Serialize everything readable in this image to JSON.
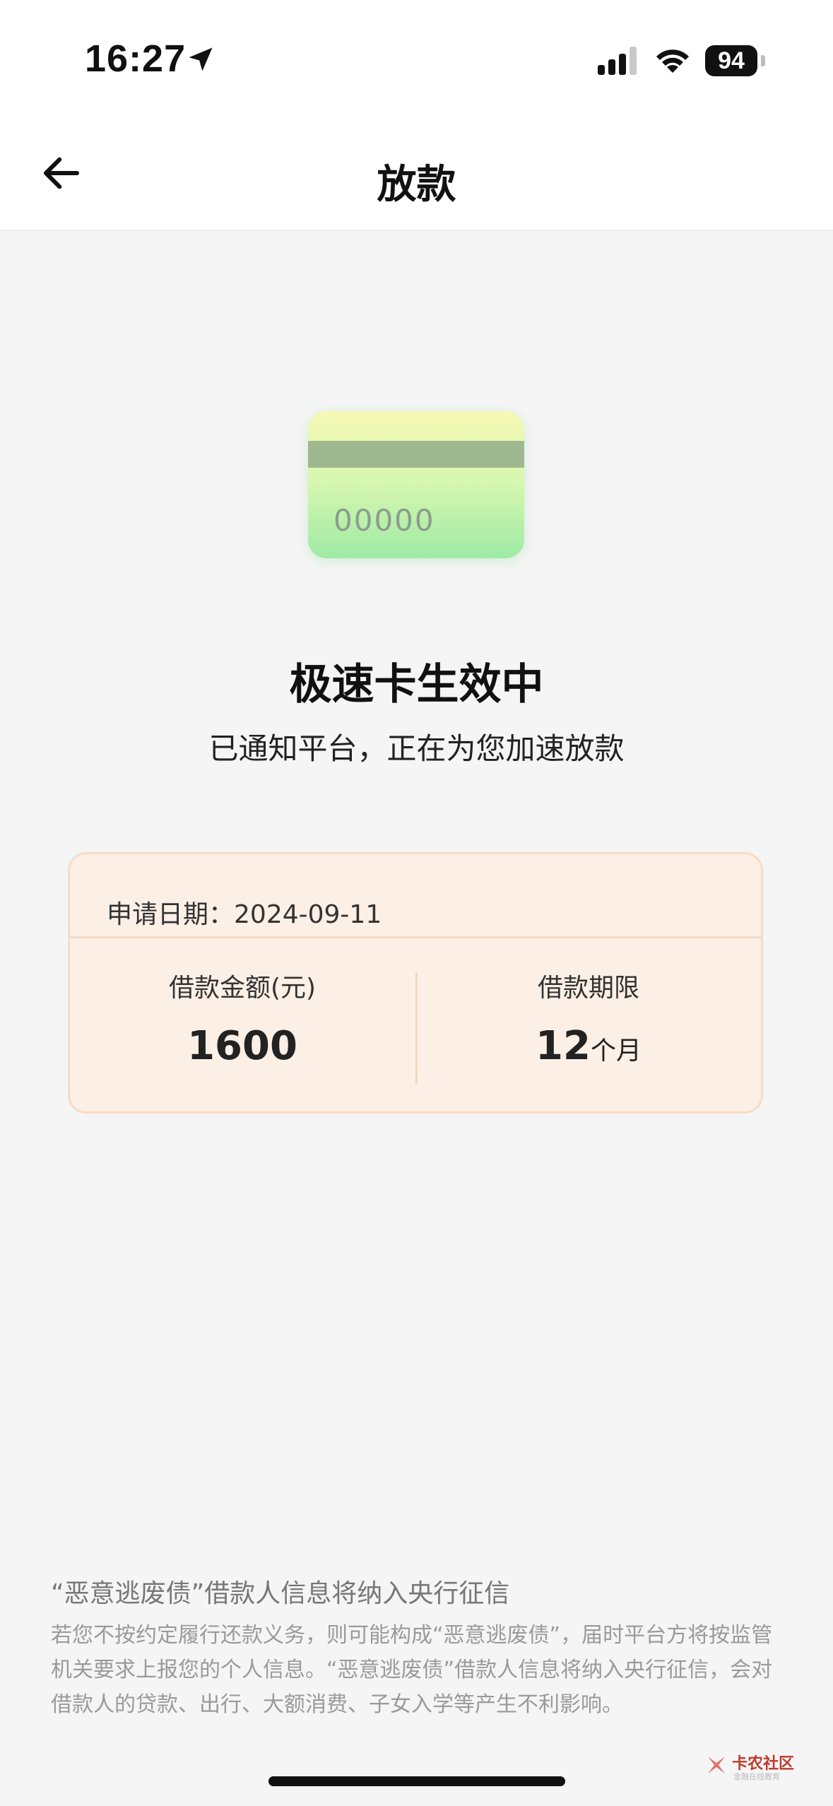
{
  "status_bar": {
    "time": "16:27",
    "battery": "94",
    "icons": [
      "location-arrow-icon",
      "cellular-signal-icon",
      "wifi-icon",
      "battery-icon"
    ]
  },
  "nav": {
    "title": "放款",
    "back_icon": "arrow-left-icon"
  },
  "card_illustration": {
    "number": "00000",
    "colors": {
      "top": "#f5f8b4",
      "bottom": "#9eeaa6",
      "stripe": "#9fb890"
    }
  },
  "status": {
    "heading": "极速卡生效中",
    "subtitle": "已通知平台，正在为您加速放款"
  },
  "loan_info": {
    "apply_date_label": "申请日期：",
    "apply_date": "2024-09-11",
    "amount_label": "借款金额(元)",
    "amount": "1600",
    "term_label": "借款期限",
    "term_value": "12",
    "term_unit": "个月",
    "colors": {
      "background": "#fcefe5",
      "border": "#f7dcc4"
    }
  },
  "notice": {
    "title": "“恶意逃废债”借款人信息将纳入央行征信",
    "body": "若您不按约定履行还款义务，则可能构成“恶意逃废债”，届时平台方将按监管机关要求上报您的个人信息。“恶意逃废债”借款人信息将纳入央行征信，会对借款人的贷款、出行、大额消费、子女入学等产生不利影响。"
  },
  "watermark": {
    "title": "卡农社区",
    "subtitle": "金融在线教育"
  }
}
